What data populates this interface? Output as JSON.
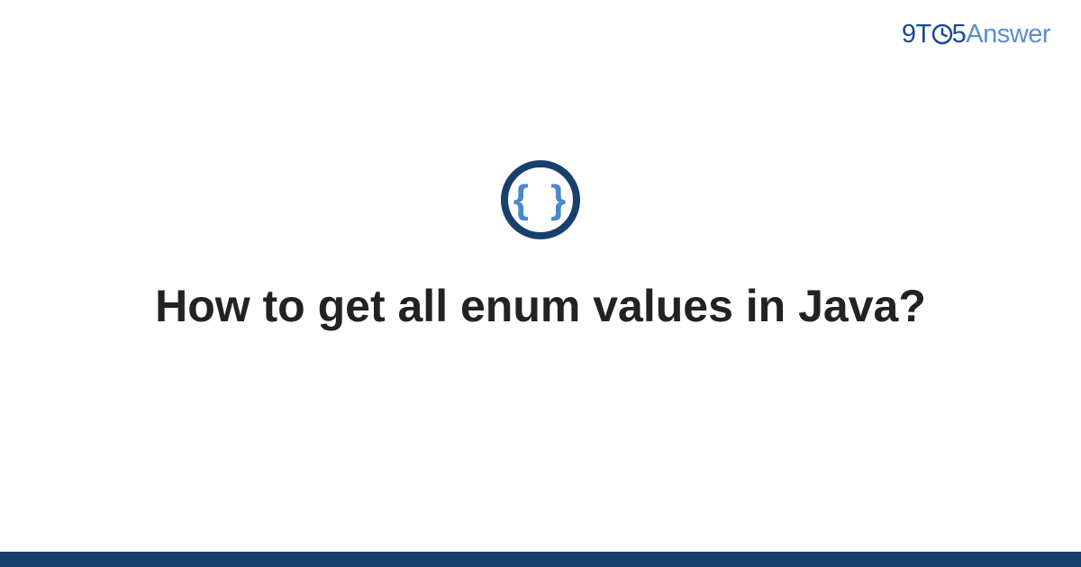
{
  "logo": {
    "part1": "9T",
    "clock": "O",
    "part3": "5",
    "part4": "Answer"
  },
  "icon": {
    "name": "braces-icon",
    "glyph": "{ }"
  },
  "title": "How to get all enum values in Java?",
  "colors": {
    "brand_dark": "#17406e",
    "brand_mid": "#1a4b8c",
    "brand_light": "#5a8dd0",
    "icon_brace": "#4a87cc",
    "text": "#222222"
  }
}
